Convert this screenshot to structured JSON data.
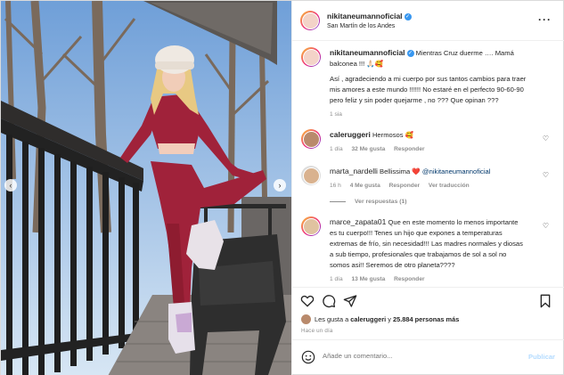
{
  "post": {
    "author": "nikitaneumannoficial",
    "location": "San Martín de los Andes"
  },
  "caption": {
    "username": "nikitaneumannoficial",
    "text_line1": "Mientras Cruz duerme …. Mamá",
    "text_line2": "balconea !!! 🙏🏻🥰",
    "text_line3": "Así , agradeciendo a mi cuerpo por sus tantos cambios para traer",
    "text_line4": "mis amores a este mundo !!!!!! No estaré en el perfecto 90-60-90",
    "text_line5": "pero feliz y sin poder quejarme , no ??? Que opinan ???",
    "time": "1 sia"
  },
  "comments": [
    {
      "username": "caleruggeri",
      "text": "Hermosos 🥰",
      "time": "1 día",
      "likes": "32 Me gusta",
      "reply": "Responder"
    },
    {
      "username": "marta_nardelli",
      "text_prefix": "Bellissima",
      "heart": "❤️",
      "mention": "@nikitaneumannoficial",
      "time": "16 h",
      "likes": "4 Me gusta",
      "reply": "Responder",
      "translate": "Ver traducción",
      "replies": "Ver respuestas (1)"
    },
    {
      "username": "marce_zapata01",
      "line1": "Que en este momento lo menos importante",
      "line2": "es tu cuerpo!!! Tenes un hijo que expones a temperaturas",
      "line3": "extremas de frío, sin necesidad!!! Las madres normales y diosas",
      "line4": "a sub tiempo, profesionales que trabajamos de sol a sol no",
      "line5": "somos asi!! Seremos de otro planeta????",
      "time": "1 día",
      "likes": "13 Me gusta",
      "reply": "Responder"
    }
  ],
  "likes": {
    "prefix": "Les gusta a",
    "user": "caleruggeri",
    "middle": "y",
    "count": "25.884 personas más"
  },
  "posted_ago": "Hace un día",
  "add_comment": {
    "placeholder": "Añade un comentario...",
    "publish": "Publicar"
  },
  "icons": {
    "more": "more-options-icon",
    "like": "heart-icon",
    "comment": "comment-icon",
    "share": "share-icon",
    "save": "bookmark-icon",
    "emoji": "emoji-icon",
    "verified": "verified-badge-icon"
  },
  "colors": {
    "verified": "#3897f0",
    "link": "#00376b",
    "muted": "#8e8e8e",
    "publish_disabled": "#b3dbff"
  }
}
